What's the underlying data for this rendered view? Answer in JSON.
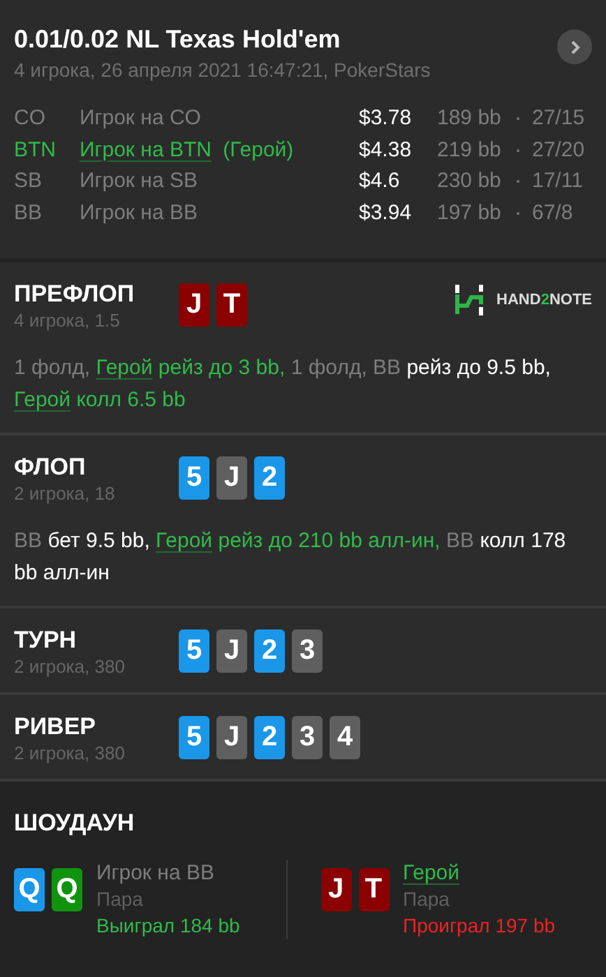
{
  "hand": {
    "title": "0.01/0.02 NL Texas Hold'em",
    "subtitle": "4 игрока, 26 апреля 2021 16:47:21, PokerStars"
  },
  "players": [
    {
      "position": "CO",
      "name": "Игрок на CO",
      "hero": false,
      "stack": "$3.78",
      "bb": "189 bb",
      "stats": "27/15"
    },
    {
      "position": "BTN",
      "name": "Игрок на BTN",
      "hero": true,
      "tag": "(Герой)",
      "stack": "$4.38",
      "bb": "219 bb",
      "stats": "27/20"
    },
    {
      "position": "SB",
      "name": "Игрок на SB",
      "hero": false,
      "stack": "$4.6",
      "bb": "230 bb",
      "stats": "17/11"
    },
    {
      "position": "BB",
      "name": "Игрок на BB",
      "hero": false,
      "stack": "$3.94",
      "bb": "197 bb",
      "stats": "67/8"
    }
  ],
  "logo": {
    "prefix": "HAND",
    "accent": "2",
    "suffix": "NOTE"
  },
  "streets": [
    {
      "name": "ПРЕФЛОП",
      "info": "4 игрока, 1.5",
      "logo": true,
      "cards": [
        {
          "rank": "J",
          "color": "#8b0000"
        },
        {
          "rank": "T",
          "color": "#8b0000"
        }
      ],
      "actions": [
        {
          "kind": "muted",
          "text": "1 фолд, "
        },
        {
          "kind": "hero_link",
          "text": "Герой"
        },
        {
          "kind": "hero",
          "text": " рейз до 3 bb, "
        },
        {
          "kind": "muted",
          "text": "1 фолд, BB "
        },
        {
          "kind": "plain",
          "text": "рейз до 9.5 bb, "
        },
        {
          "kind": "hero_link",
          "text": "Герой"
        },
        {
          "kind": "hero",
          "text": " колл 6.5 bb"
        }
      ]
    },
    {
      "name": "ФЛОП",
      "info": "2 игрока, 18",
      "logo": false,
      "cards": [
        {
          "rank": "5",
          "color": "#1a97e8"
        },
        {
          "rank": "J",
          "color": "#5f5f5f"
        },
        {
          "rank": "2",
          "color": "#1a97e8"
        }
      ],
      "actions": [
        {
          "kind": "muted",
          "text": "BB "
        },
        {
          "kind": "plain",
          "text": "бет 9.5 bb, "
        },
        {
          "kind": "hero_link",
          "text": "Герой"
        },
        {
          "kind": "hero",
          "text": " рейз до 210 bb алл-ин, "
        },
        {
          "kind": "muted",
          "text": "BB "
        },
        {
          "kind": "plain",
          "text": "колл 178 bb алл-ин"
        }
      ]
    },
    {
      "name": "ТУРН",
      "info": "2 игрока, 380",
      "logo": false,
      "cards": [
        {
          "rank": "5",
          "color": "#1a97e8"
        },
        {
          "rank": "J",
          "color": "#5f5f5f"
        },
        {
          "rank": "2",
          "color": "#1a97e8"
        },
        {
          "rank": "3",
          "color": "#5f5f5f"
        }
      ]
    },
    {
      "name": "РИВЕР",
      "info": "2 игрока, 380",
      "logo": false,
      "cards": [
        {
          "rank": "5",
          "color": "#1a97e8"
        },
        {
          "rank": "J",
          "color": "#5f5f5f"
        },
        {
          "rank": "2",
          "color": "#1a97e8"
        },
        {
          "rank": "3",
          "color": "#5f5f5f"
        },
        {
          "rank": "4",
          "color": "#5f5f5f"
        }
      ]
    }
  ],
  "showdown": {
    "title": "ШОУДАУН",
    "hands": [
      {
        "player": "Игрок на BB",
        "hero": false,
        "combo": "Пара",
        "won": true,
        "result": "Выиграл 184 bb",
        "cards": [
          {
            "rank": "Q",
            "color": "#1a97e8"
          },
          {
            "rank": "Q",
            "color": "#109410"
          }
        ]
      },
      {
        "player": "Герой",
        "hero": true,
        "combo": "Пара",
        "won": false,
        "result": "Проиграл 197 bb",
        "cards": [
          {
            "rank": "J",
            "color": "#8b0000"
          },
          {
            "rank": "T",
            "color": "#8b0000"
          }
        ]
      }
    ]
  }
}
